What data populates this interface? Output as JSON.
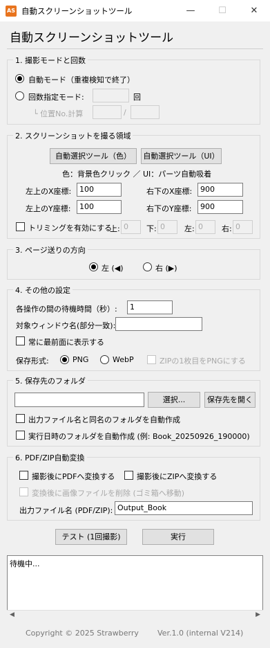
{
  "window": {
    "icon_text": "AS",
    "title": "自動スクリーンショットツール",
    "minimize_glyph": "—",
    "maximize_glyph": "☐",
    "close_glyph": "✕"
  },
  "header": "自動スクリーンショットツール",
  "section1": {
    "title": "1. 撮影モードと回数",
    "auto_mode_label": "自動モード（重複検知で終了）",
    "count_mode_label": "回数指定モード:",
    "count_value": "",
    "count_unit": "回",
    "position_label": "└ 位置No.計算",
    "position_start": "",
    "position_sep": "/",
    "position_end": ""
  },
  "section2": {
    "title": "2. スクリーンショットを撮る領域",
    "btn_auto_color": "自動選択ツール（色）",
    "btn_auto_ui": "自動選択ツール（UI）",
    "hint": "色：背景色クリック ／ UI：パーツ自動吸着",
    "tl_x_label": "左上のX座標:",
    "tl_x_value": "100",
    "br_x_label": "右下のX座標:",
    "br_x_value": "900",
    "tl_y_label": "左上のY座標:",
    "tl_y_value": "100",
    "br_y_label": "右下のY座標:",
    "br_y_value": "900",
    "trim_label": "トリミングを有効にする",
    "trim_top_label": "上:",
    "trim_top": "0",
    "trim_bottom_label": "下:",
    "trim_bottom": "0",
    "trim_left_label": "左:",
    "trim_left": "0",
    "trim_right_label": "右:",
    "trim_right": "0"
  },
  "section3": {
    "title": "3. ページ送りの方向",
    "left_label": "左 (◀)",
    "right_label": "右 (▶)"
  },
  "section4": {
    "title": "4. その他の設定",
    "wait_label": "各操作の間の待機時間（秒）:",
    "wait_value": "1",
    "window_label": "対象ウィンドウ名(部分一致):",
    "window_value": "",
    "topmost_label": "常に最前面に表示する",
    "format_label": "保存形式:",
    "png_label": "PNG",
    "webp_label": "WebP",
    "zip_png_label": "ZIPの1枚目をPNGにする"
  },
  "section5": {
    "title": "5. 保存先のフォルダ",
    "folder_value": "",
    "select_btn": "選択...",
    "open_btn": "保存先を開く",
    "same_name_label": "出力ファイル名と同名のフォルダを自動作成",
    "datetime_label": "実行日時のフォルダを自動作成  (例: Book_20250926_190000)"
  },
  "section6": {
    "title": "6. PDF/ZIP自動変換",
    "pdf_label": "撮影後にPDFへ変換する",
    "zip_label": "撮影後にZIPへ変換する",
    "delete_label": "変換後に画像ファイルを削除 (ゴミ箱へ移動)",
    "output_label": "出力ファイル名 (PDF/ZIP):",
    "output_value": "Output_Book"
  },
  "actions": {
    "test_btn": "テスト (1回撮影)",
    "run_btn": "実行"
  },
  "log": {
    "text": "待機中..."
  },
  "footer": {
    "copyright": "Copyright © 2025 Strawberry",
    "version": "Ver.1.0 (internal V214)"
  }
}
